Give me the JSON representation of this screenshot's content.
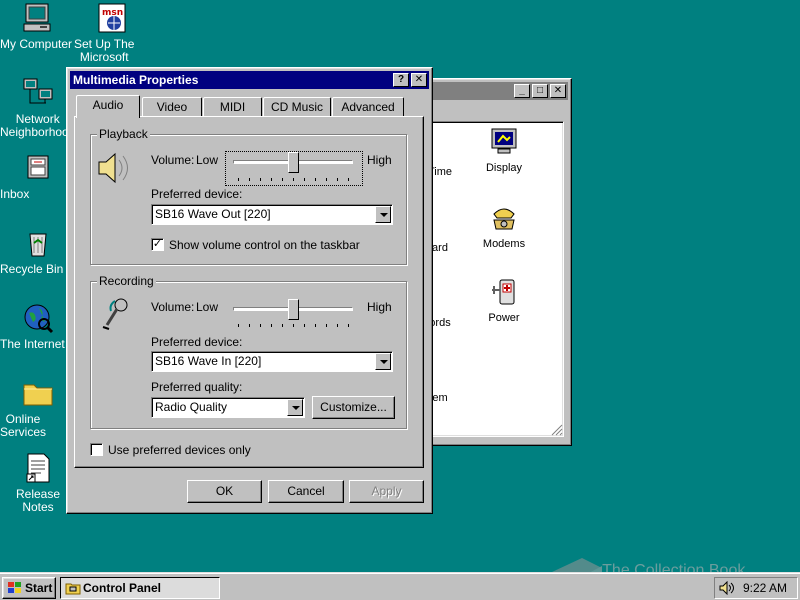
{
  "desktop": {
    "icons": [
      {
        "label": "My Computer"
      },
      {
        "label": "Set Up The\nMicrosoft"
      },
      {
        "label": "Network\nNeighborhood"
      },
      {
        "label": "Inbox"
      },
      {
        "label": "Recycle Bin"
      },
      {
        "label": "The Internet"
      },
      {
        "label": "Online\nServices"
      },
      {
        "label": "Release Notes"
      }
    ]
  },
  "control_panel": {
    "items": [
      {
        "label": "Time"
      },
      {
        "label": "Display"
      },
      {
        "label": "ard"
      },
      {
        "label": "Modems"
      },
      {
        "label": "ords"
      },
      {
        "label": "Power"
      },
      {
        "label": "em"
      }
    ]
  },
  "dialog": {
    "title": "Multimedia Properties",
    "help_btn": "?",
    "close_btn": "✕",
    "tabs": [
      "Audio",
      "Video",
      "MIDI",
      "CD Music",
      "Advanced"
    ],
    "active_tab": "Audio",
    "playback": {
      "group_label": "Playback",
      "volume_label": "Volume:",
      "low": "Low",
      "high": "High",
      "volume_level": 0.5,
      "device_label": "Preferred device:",
      "device_value": "SB16 Wave Out [220]",
      "show_volume_label": "Show volume control on the taskbar",
      "show_volume_checked": true
    },
    "recording": {
      "group_label": "Recording",
      "volume_label": "Volume:",
      "low": "Low",
      "high": "High",
      "volume_level": 0.5,
      "device_label": "Preferred device:",
      "device_value": "SB16 Wave In [220]",
      "quality_label": "Preferred quality:",
      "quality_value": "Radio Quality",
      "customize_label": "Customize..."
    },
    "use_preferred_label": "Use preferred devices only",
    "use_preferred_checked": false,
    "ok_label": "OK",
    "cancel_label": "Cancel",
    "apply_label": "Apply"
  },
  "taskbar": {
    "start_label": "Start",
    "task_label": "Control Panel",
    "clock": "9:22 AM"
  },
  "watermark": "The Collection Book",
  "colors": {
    "desktop": "#008080",
    "title_active": "#000080",
    "title_inactive": "#808080",
    "face": "#c0c0c0"
  }
}
